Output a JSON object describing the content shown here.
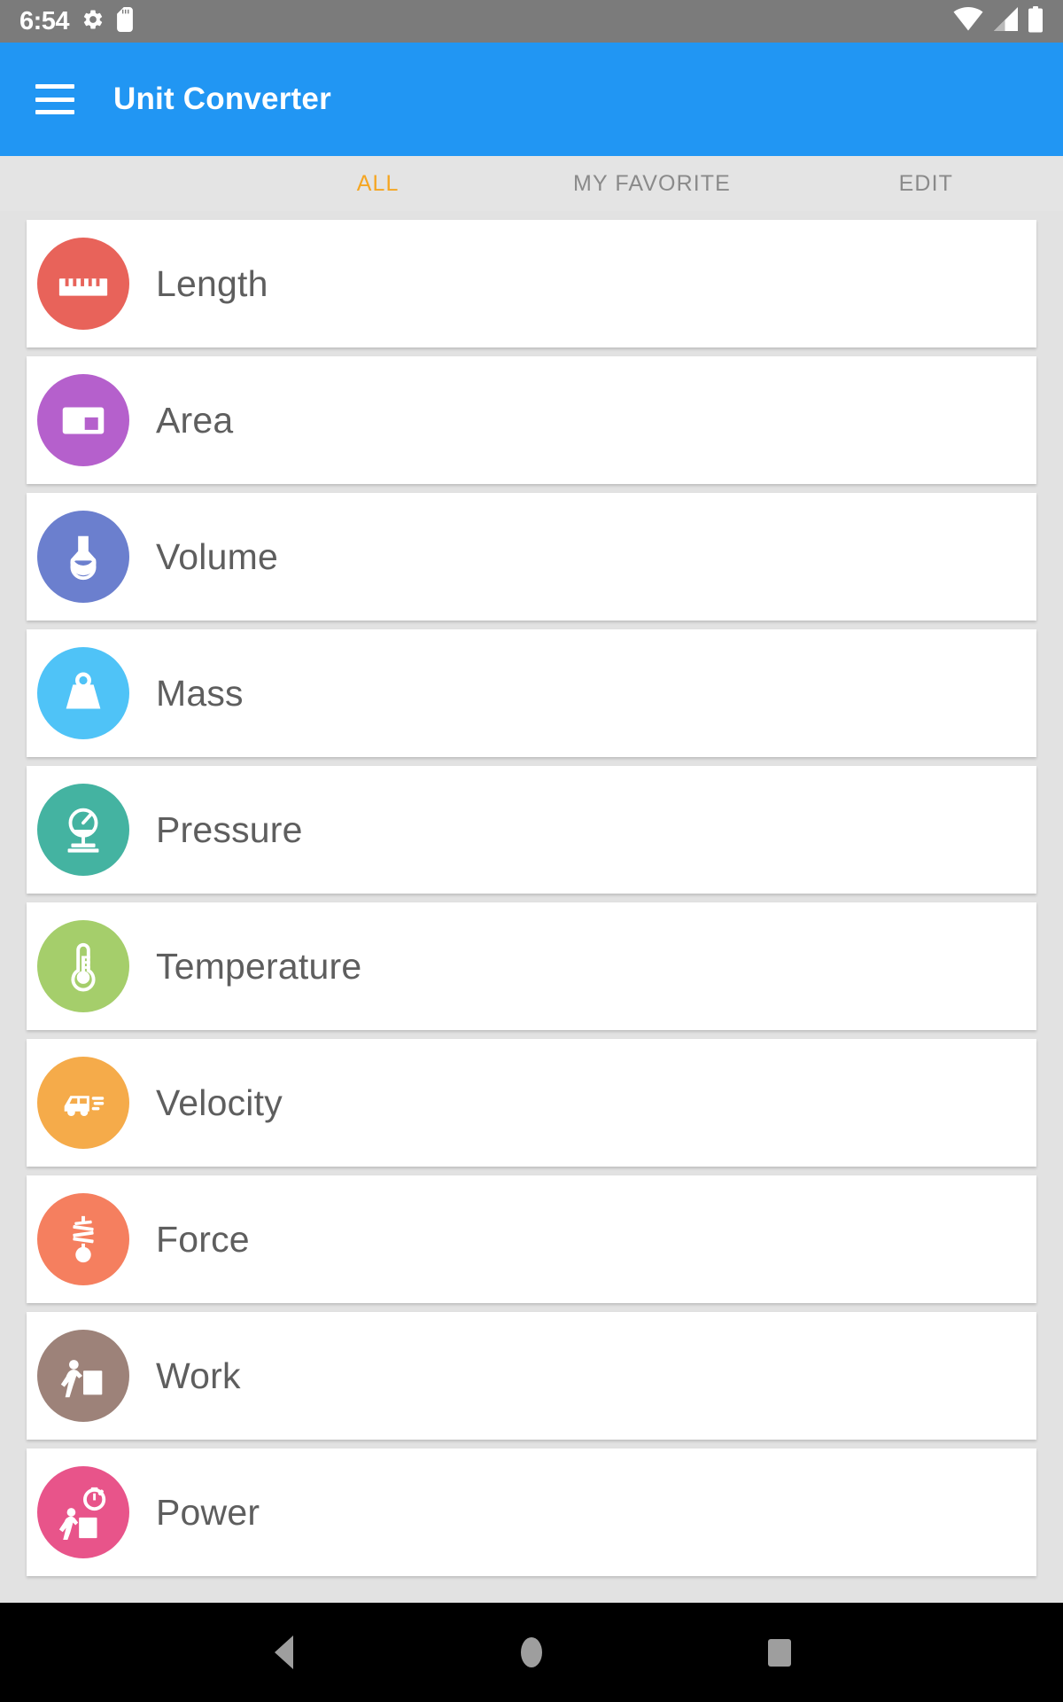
{
  "status_bar": {
    "time": "6:54",
    "left_icons": [
      "gear-icon",
      "sd-card-icon"
    ],
    "right_icons": [
      "wifi-icon",
      "cellular-signal-icon",
      "battery-icon"
    ],
    "background_color": "#7b7b7b"
  },
  "app_bar": {
    "menu_icon": "hamburger-menu-icon",
    "title": "Unit Converter",
    "background_color": "#2196f3",
    "text_color": "#ffffff"
  },
  "tabs": {
    "active_index": 0,
    "active_color": "#f5a623",
    "inactive_color": "#8a8a8a",
    "items": [
      {
        "label": "ALL"
      },
      {
        "label": "MY FAVORITE"
      },
      {
        "label": "EDIT"
      }
    ]
  },
  "categories": [
    {
      "label": "Length",
      "icon": "ruler-icon",
      "color": "#e8635a"
    },
    {
      "label": "Area",
      "icon": "area-rect-icon",
      "color": "#b560cc"
    },
    {
      "label": "Volume",
      "icon": "flask-icon",
      "color": "#6b7fce"
    },
    {
      "label": "Mass",
      "icon": "weight-icon",
      "color": "#4fc3f7"
    },
    {
      "label": "Pressure",
      "icon": "gauge-icon",
      "color": "#44b3a1"
    },
    {
      "label": "Temperature",
      "icon": "thermometer-icon",
      "color": "#a5ce6b"
    },
    {
      "label": "Velocity",
      "icon": "van-speed-icon",
      "color": "#f5ab4a"
    },
    {
      "label": "Force",
      "icon": "spring-scale-icon",
      "color": "#f57f5f"
    },
    {
      "label": "Work",
      "icon": "person-push-box-icon",
      "color": "#9d8279"
    },
    {
      "label": "Power",
      "icon": "person-push-box-timer-icon",
      "color": "#e8548a"
    }
  ],
  "nav_bar": {
    "background_color": "#000000",
    "buttons": [
      {
        "name": "back"
      },
      {
        "name": "home"
      },
      {
        "name": "recents"
      }
    ]
  }
}
